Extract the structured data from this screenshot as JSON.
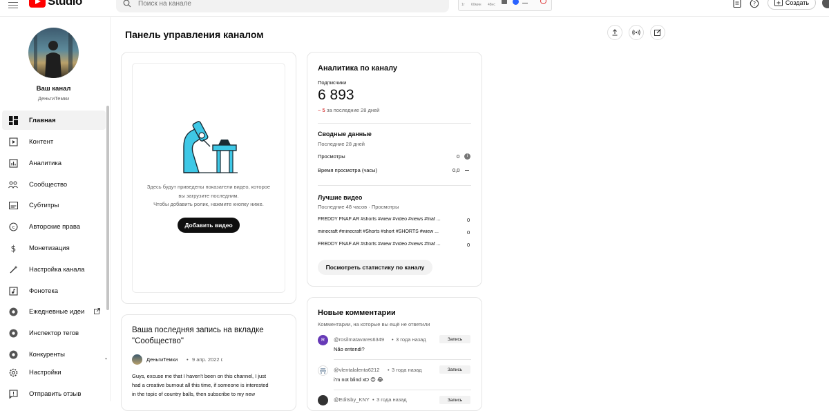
{
  "topbar": {
    "logo_text": "Studio",
    "search_placeholder": "Поиск на канале",
    "ext_labels": [
      "1г",
      "60мин",
      "48нс"
    ],
    "create_label": "Создать"
  },
  "channel": {
    "title": "Ваш канал",
    "name": "ДеньгиТемки"
  },
  "sidebar": {
    "items": [
      {
        "label": "Главная",
        "icon": "dashboard-icon",
        "active": true
      },
      {
        "label": "Контент",
        "icon": "content-icon"
      },
      {
        "label": "Аналитика",
        "icon": "analytics-icon"
      },
      {
        "label": "Сообщество",
        "icon": "community-icon"
      },
      {
        "label": "Субтитры",
        "icon": "subtitles-icon"
      },
      {
        "label": "Авторские права",
        "icon": "copyright-icon"
      },
      {
        "label": "Монетизация",
        "icon": "dollar-icon"
      },
      {
        "label": "Настройка канала",
        "icon": "magic-wand-icon"
      },
      {
        "label": "Фонотека",
        "icon": "audio-library-icon"
      },
      {
        "label": "Ежедневные идеи",
        "icon": "extension-icon"
      },
      {
        "label": "Инспектор тегов",
        "icon": "extension-icon"
      },
      {
        "label": "Конкуренты",
        "icon": "extension-icon"
      },
      {
        "label": "Настройки",
        "icon": "gear-icon"
      },
      {
        "label": "Отправить отзыв",
        "icon": "feedback-icon"
      }
    ]
  },
  "main": {
    "title": "Панель управления каналом",
    "upload_card": {
      "text_line1": "Здесь будут приведены показатели видео, которое",
      "text_line2": "вы загрузите последним.",
      "text_line3": "Чтобы добавить ролик, нажмите кнопку ниже.",
      "button": "Добавить видео"
    },
    "community_card": {
      "title_line1": "Ваша последняя запись на вкладке",
      "title_line2": "\"Сообщество\"",
      "author": "ДеньгиТемки",
      "date": "9 апр. 2022 г.",
      "body_line1": "Guys, excuse me that I haven't been on this channel, I just",
      "body_line2": "had a creative burnout all this time, if someone is interested",
      "body_line3": "in the topic of country balls, then subscribe to my new"
    },
    "analytics": {
      "title": "Аналитика по каналу",
      "subs_label": "Подписчики",
      "subs_value": "6 893",
      "subs_delta_prefix": "− 5",
      "subs_delta_suffix": "за последние 28 дней",
      "summary_title": "Сводные данные",
      "summary_period": "Последние 28 дней",
      "rows": [
        {
          "label": "Просмотры",
          "value": "0"
        },
        {
          "label": "Время просмотра (часы)",
          "value": "0,0"
        }
      ],
      "top_title": "Лучшие видео",
      "top_period": "Последние 48 часов · Просмотры",
      "top_videos": [
        {
          "title": "FREDDY FNAF AR #shorts #wiew #video #views #fnaf ...",
          "value": "0"
        },
        {
          "title": "minecraft #minecraft #Shorts #short #SHORTS #wiew ...",
          "value": "0"
        },
        {
          "title": "FREDDY FNAF AR #shorts #wiew #video #views #fnaf ...",
          "value": "0"
        }
      ],
      "button": "Посмотреть статистику по каналу"
    },
    "comments": {
      "title": "Новые комментарии",
      "subtitle": "Комментарии, на которые вы ещё не ответили",
      "items": [
        {
          "avatar": "R",
          "author": "@rosilmatavares6349",
          "time": "3 года назад",
          "text": "Não entendi?",
          "tag": "Запись"
        },
        {
          "avatar": "",
          "author": "@vlentalalenta6212",
          "time": "3 года назад",
          "text": "i'm not blind xD 😍 😂",
          "tag": "Запись"
        },
        {
          "avatar": "",
          "author": "@Editsby_KNY",
          "time": "3 года назад",
          "text": "",
          "tag": "Запись"
        }
      ]
    }
  },
  "colors": {
    "accent": "#ff0000",
    "delta_negative": "#cc0000",
    "illustration": "#3fc8e6"
  }
}
